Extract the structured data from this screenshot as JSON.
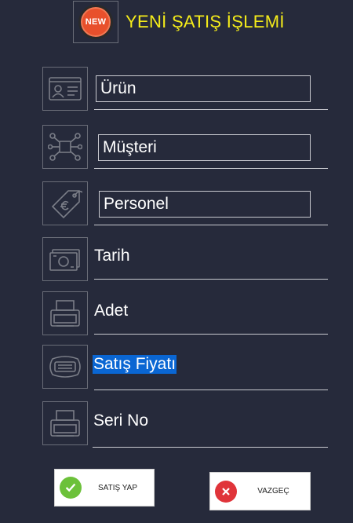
{
  "header": {
    "badge_text": "NEW",
    "title": "YENİ ŞATIŞ İŞLEMİ"
  },
  "fields": {
    "urun": "Ürün",
    "musteri": "Müşteri",
    "personel": "Personel",
    "tarih": "Tarih",
    "adet": "Adet",
    "satis_fiyati": "Satış Fiyatı",
    "seri_no": "Seri No"
  },
  "icons": {
    "urun": "id-card-icon",
    "musteri": "network-icon",
    "personel": "price-tag-icon",
    "tarih": "banknote-icon",
    "adet": "printer-icon",
    "satis_fiyati": "card-icon",
    "seri_no": "printer-icon"
  },
  "buttons": {
    "confirm": "SATIŞ YAP",
    "cancel": "VAZGEÇ"
  },
  "colors": {
    "background": "#262a3b",
    "title": "#f5ec1a",
    "selection": "#0a66d3",
    "confirm_icon": "#6cc13a",
    "cancel_icon": "#e0343a"
  }
}
